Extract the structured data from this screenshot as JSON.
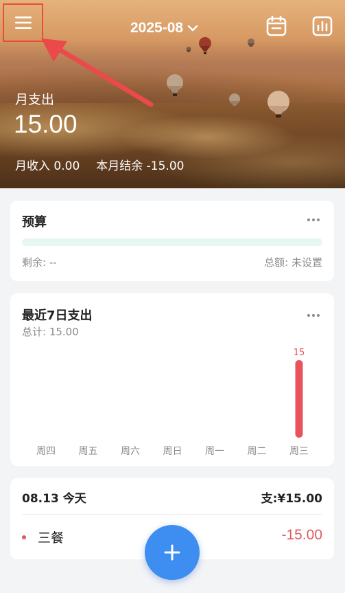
{
  "header": {
    "month": "2025-08",
    "monthly_expense_label": "月支出",
    "monthly_expense_value": "15.00",
    "monthly_income": "月收入 0.00",
    "monthly_balance": "本月结余 -15.00"
  },
  "icons": {
    "menu": "hamburger-menu-icon",
    "month_dropdown": "chevron-down-icon",
    "calendar": "calendar-icon",
    "stats": "bar-chart-icon",
    "add": "plus-icon",
    "more": "more-dots-icon"
  },
  "budget": {
    "title": "预算",
    "remaining": "剩余: --",
    "total": "总额: 未设置",
    "progress": 0
  },
  "recent": {
    "title": "最近7日支出",
    "total": "总计: 15.00"
  },
  "chart_data": {
    "type": "bar",
    "title": "最近7日支出",
    "categories": [
      "周四",
      "周五",
      "周六",
      "周日",
      "周一",
      "周二",
      "周三"
    ],
    "values": [
      0,
      0,
      0,
      0,
      0,
      0,
      15
    ],
    "data_labels": [
      "",
      "",
      "",
      "",
      "",
      "",
      "15"
    ],
    "bar_color": "#e8535e",
    "grid": false
  },
  "day_record": {
    "date": "08.13 今天",
    "summary": "支:¥15.00",
    "items": [
      {
        "name": "三餐",
        "amount": "-15.00"
      }
    ]
  },
  "colors": {
    "accent": "#3d8ef0",
    "expense_red": "#e05a5a",
    "highlight_box": "#e74c3c",
    "budget_bar": "#e8f7f2"
  }
}
